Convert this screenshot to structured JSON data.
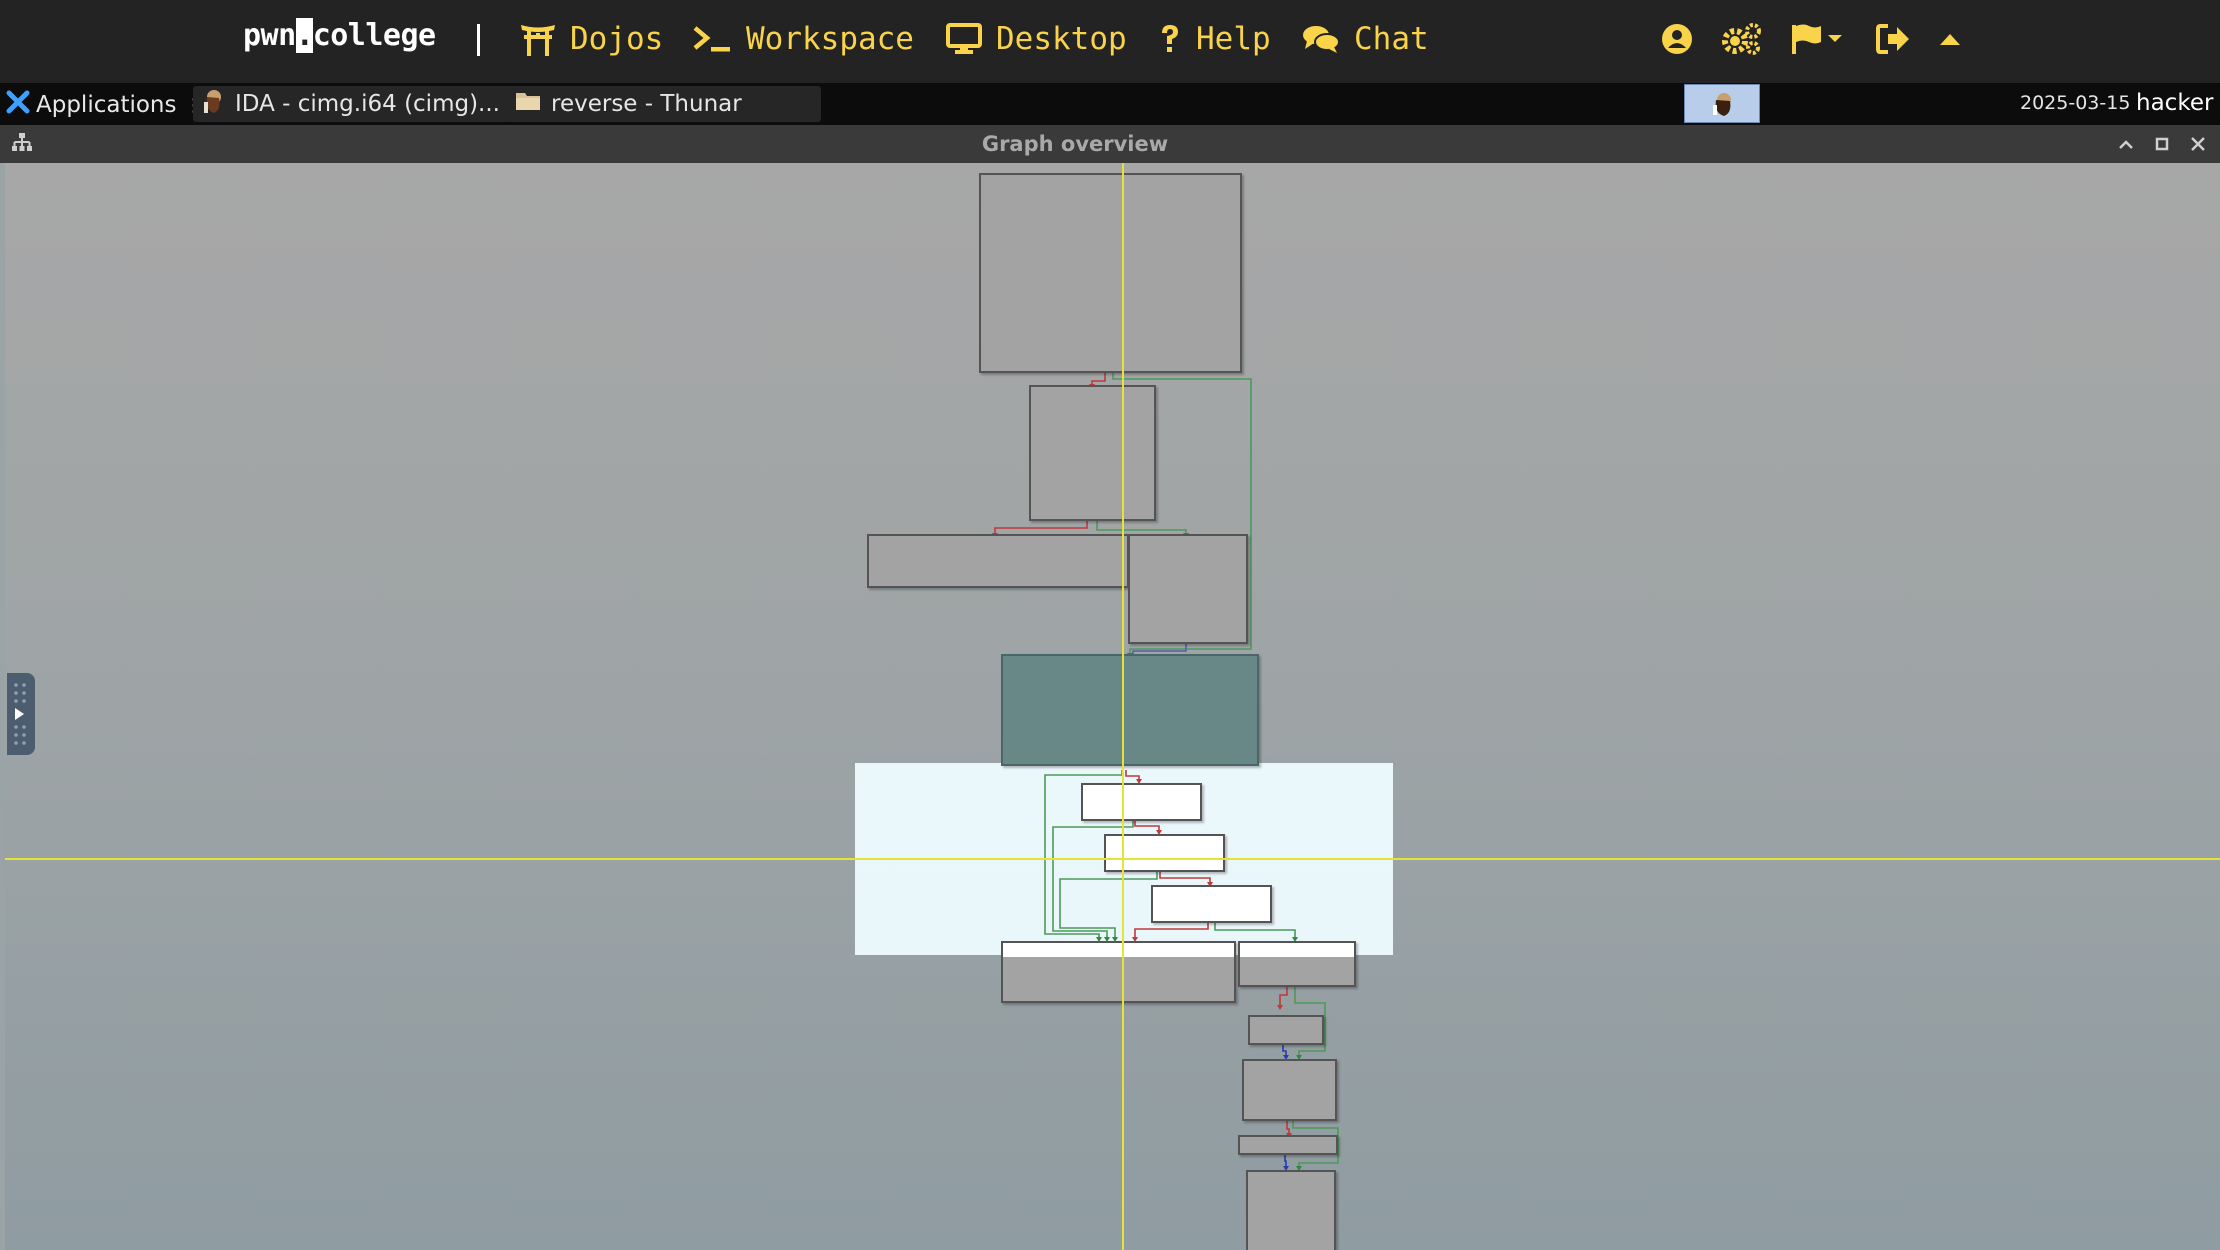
{
  "site": {
    "brand_left": "pwn",
    "brand_cursor": ".",
    "brand_right": "college",
    "nav": [
      {
        "label": "Dojos",
        "icon": "torii-gate-icon"
      },
      {
        "label": "Workspace",
        "icon": "terminal-icon"
      },
      {
        "label": "Desktop",
        "icon": "desktop-icon"
      },
      {
        "label": "Help",
        "icon": "question-icon"
      },
      {
        "label": "Chat",
        "icon": "chat-bubbles-icon"
      }
    ],
    "right_icons": [
      "user-circle-icon",
      "cogs-icon",
      "flag-icon",
      "sign-out-icon",
      "caret-up-icon"
    ],
    "accent_color": "#f9d34a",
    "background_color": "#232323"
  },
  "taskbar": {
    "apps_label": "Applications",
    "tasks": [
      {
        "label": "IDA - cimg.i64 (cimg)...",
        "icon": "ida-icon"
      },
      {
        "label": "reverse - Thunar",
        "icon": "folder-icon"
      }
    ],
    "date": "2025-03-15",
    "user": "hacker"
  },
  "window": {
    "title": "Graph overview",
    "buttons": [
      "minimize-icon",
      "maximize-icon",
      "close-icon"
    ],
    "current_node_color": "#688888",
    "viewport_color": "#eefcff",
    "crosshair_color": "#e5e23a"
  }
}
